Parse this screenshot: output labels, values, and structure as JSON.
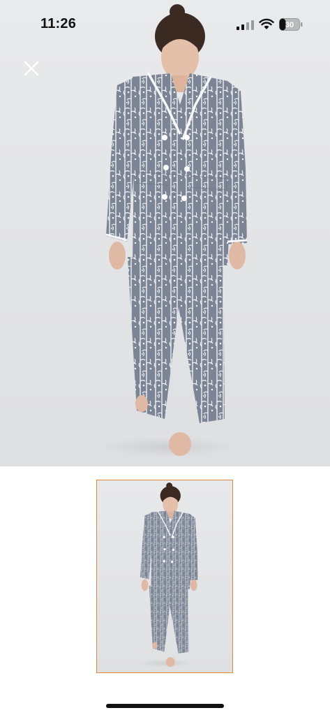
{
  "status_bar": {
    "time": "11:26",
    "battery_level": "30",
    "icons": [
      "cellular-signal-icon",
      "wifi-icon",
      "battery-icon"
    ]
  },
  "viewer": {
    "close_icon": "close-icon",
    "main_image": "product-photo-patterned-pajama-set",
    "thumbnails": [
      {
        "image": "product-photo-patterned-pajama-set",
        "selected": true
      }
    ],
    "selected_border_color": "#e2873a"
  },
  "colors": {
    "fabric": "#7f8898",
    "print": "#f1f2f4",
    "background": "#e5e6e8"
  }
}
